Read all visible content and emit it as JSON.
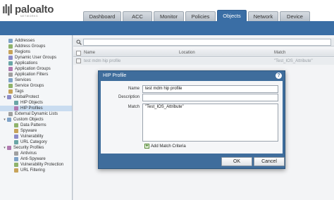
{
  "header": {
    "brand": "paloalto",
    "brand_sub": "NETWORKS",
    "tabs": [
      {
        "label": "Dashboard"
      },
      {
        "label": "ACC"
      },
      {
        "label": "Monitor"
      },
      {
        "label": "Policies"
      },
      {
        "label": "Objects",
        "active": true
      },
      {
        "label": "Network"
      },
      {
        "label": "Device"
      }
    ]
  },
  "colors": {
    "accent": "#3a6ea5",
    "modal": "#3f6d9c",
    "selected_row": "#c9dcf0"
  },
  "sidebar": {
    "items": [
      {
        "label": "Addresses",
        "icon": "address-icon",
        "indent": 1
      },
      {
        "label": "Address Groups",
        "icon": "address-group-icon",
        "indent": 1
      },
      {
        "label": "Regions",
        "icon": "region-icon",
        "indent": 1
      },
      {
        "label": "Dynamic User Groups",
        "icon": "user-group-icon",
        "indent": 1
      },
      {
        "label": "Applications",
        "icon": "application-icon",
        "indent": 1
      },
      {
        "label": "Application Groups",
        "icon": "application-group-icon",
        "indent": 1
      },
      {
        "label": "Application Filters",
        "icon": "application-filter-icon",
        "indent": 1
      },
      {
        "label": "Services",
        "icon": "service-icon",
        "indent": 1
      },
      {
        "label": "Service Groups",
        "icon": "service-group-icon",
        "indent": 1
      },
      {
        "label": "Tags",
        "icon": "tag-icon",
        "indent": 1
      },
      {
        "label": "GlobalProtect",
        "icon": "globalprotect-icon",
        "indent": 0,
        "expanded": true
      },
      {
        "label": "HIP Objects",
        "icon": "hip-object-icon",
        "indent": 2
      },
      {
        "label": "HIP Profiles",
        "icon": "hip-profile-icon",
        "indent": 2,
        "selected": true
      },
      {
        "label": "External Dynamic Lists",
        "icon": "external-list-icon",
        "indent": 1
      },
      {
        "label": "Custom Objects",
        "icon": "custom-object-icon",
        "indent": 0,
        "expanded": true
      },
      {
        "label": "Data Patterns",
        "icon": "data-pattern-icon",
        "indent": 2
      },
      {
        "label": "Spyware",
        "icon": "spyware-icon",
        "indent": 2
      },
      {
        "label": "Vulnerability",
        "icon": "vulnerability-icon",
        "indent": 2
      },
      {
        "label": "URL Category",
        "icon": "url-category-icon",
        "indent": 2
      },
      {
        "label": "Security Profiles",
        "icon": "security-profile-icon",
        "indent": 0,
        "expanded": true
      },
      {
        "label": "Antivirus",
        "icon": "antivirus-icon",
        "indent": 2
      },
      {
        "label": "Anti-Spyware",
        "icon": "anti-spyware-icon",
        "indent": 2
      },
      {
        "label": "Vulnerability Protection",
        "icon": "vulnerability-protection-icon",
        "indent": 2
      },
      {
        "label": "URL Filtering",
        "icon": "url-filtering-icon",
        "indent": 2
      }
    ]
  },
  "grid": {
    "columns": {
      "name": "Name",
      "location": "Location",
      "match": "Match"
    },
    "rows": [
      {
        "name": "test mdm hip profile",
        "location": "",
        "match": "\"Test_IOS_Attribute\""
      }
    ]
  },
  "modal": {
    "title": "HIP Profile",
    "help_symbol": "?",
    "name_label": "Name",
    "name_value": "test mdm hip profile",
    "description_label": "Description",
    "description_value": "",
    "match_label": "Match",
    "match_value": "\"Test_IOS_Attribute\"",
    "add_match_label": "Add Match Criteria",
    "ok_label": "OK",
    "cancel_label": "Cancel"
  }
}
